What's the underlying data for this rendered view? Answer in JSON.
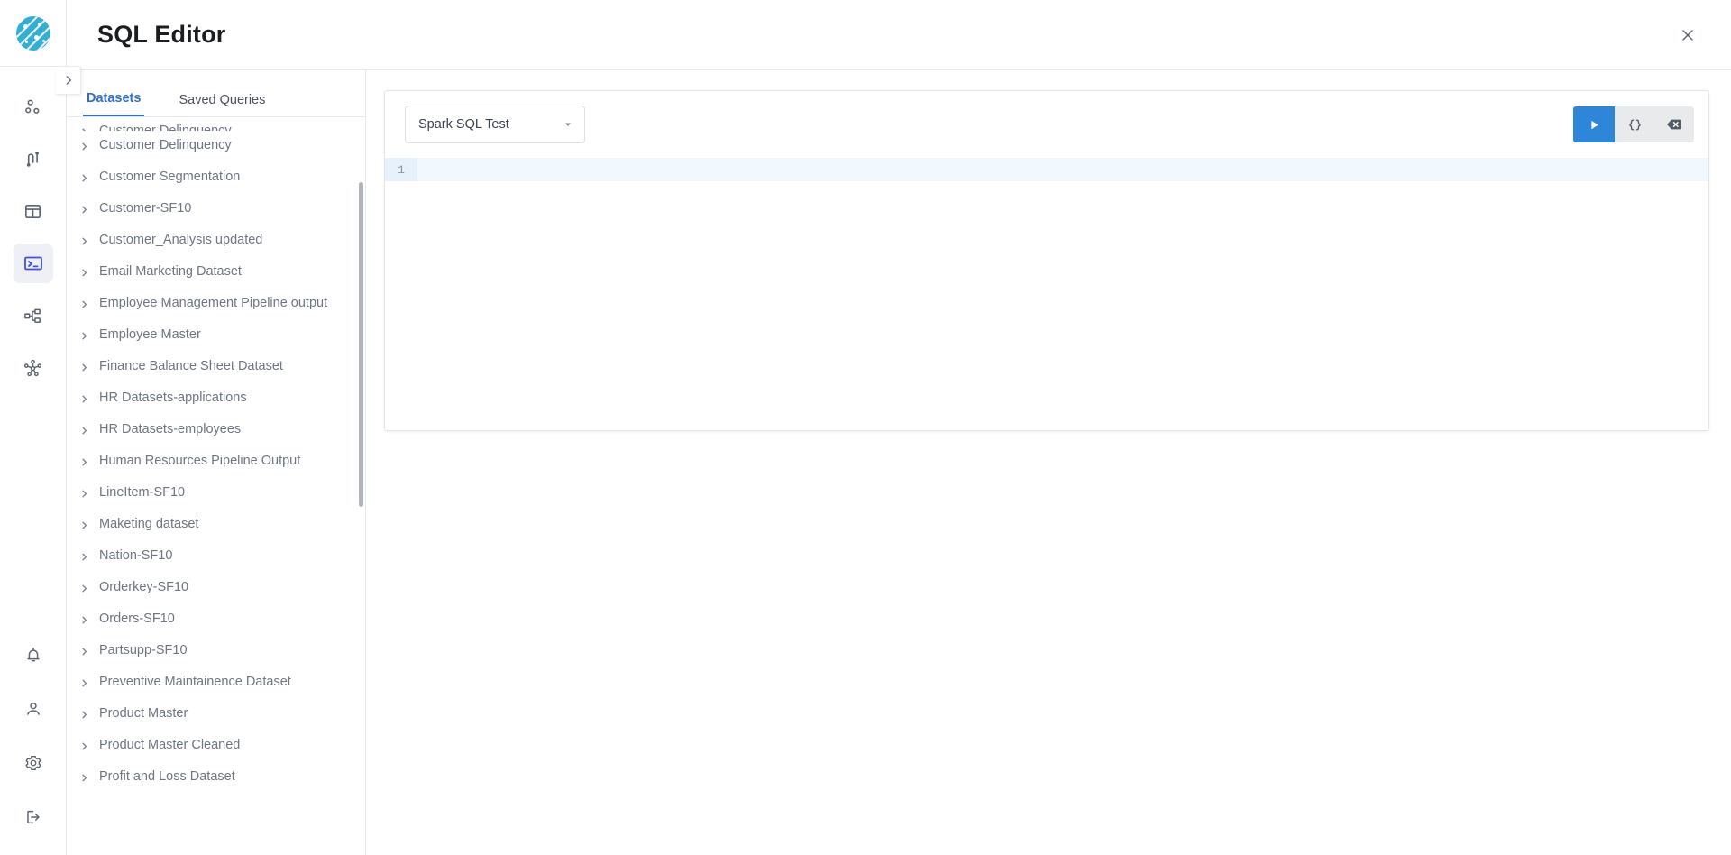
{
  "app": {
    "logo_icon": "circular-textured-logo",
    "title": "SQL Editor",
    "close_icon": "close-icon",
    "collapse_icon": "chevron-right-icon"
  },
  "rail": {
    "items": [
      {
        "name": "data-nodes",
        "icon": "scatter-nodes-icon",
        "active": false
      },
      {
        "name": "pipelines",
        "icon": "connectors-icon",
        "active": false
      },
      {
        "name": "tables",
        "icon": "table-icon",
        "active": false
      },
      {
        "name": "sql-editor",
        "icon": "terminal-icon",
        "active": true
      },
      {
        "name": "workflow",
        "icon": "hierarchy-icon",
        "active": false
      },
      {
        "name": "lineage",
        "icon": "network-graph-icon",
        "active": false
      }
    ],
    "bottom_items": [
      {
        "name": "notifications",
        "icon": "bell-icon"
      },
      {
        "name": "profile",
        "icon": "user-icon"
      },
      {
        "name": "settings",
        "icon": "gear-icon"
      },
      {
        "name": "logout",
        "icon": "logout-icon"
      }
    ]
  },
  "panel": {
    "tabs": [
      {
        "label": "Datasets",
        "active": true
      },
      {
        "label": "Saved Queries",
        "active": false
      }
    ],
    "datasets": [
      {
        "label": "Customer Delinquency",
        "clipped": "top"
      },
      {
        "label": "Customer Delinquency"
      },
      {
        "label": "Customer Segmentation"
      },
      {
        "label": "Customer-SF10"
      },
      {
        "label": "Customer_Analysis updated"
      },
      {
        "label": "Email Marketing Dataset"
      },
      {
        "label": "Employee Management Pipeline output"
      },
      {
        "label": "Employee Master"
      },
      {
        "label": "Finance Balance Sheet Dataset"
      },
      {
        "label": "HR Datasets-applications"
      },
      {
        "label": "HR Datasets-employees"
      },
      {
        "label": "Human Resources Pipeline Output"
      },
      {
        "label": "LineItem-SF10"
      },
      {
        "label": "Maketing dataset"
      },
      {
        "label": "Nation-SF10"
      },
      {
        "label": "Orderkey-SF10"
      },
      {
        "label": "Orders-SF10"
      },
      {
        "label": "Partsupp-SF10"
      },
      {
        "label": "Preventive Maintainence Dataset"
      },
      {
        "label": "Product Master"
      },
      {
        "label": "Product Master Cleaned"
      },
      {
        "label": "Profit and Loss Dataset"
      }
    ],
    "item_caret_icon": "chevron-right-icon"
  },
  "editor": {
    "dataset_select": {
      "value": "Spark SQL Test",
      "caret_icon": "chevron-down-icon"
    },
    "actions": [
      {
        "name": "run-query-button",
        "icon": "play-icon",
        "primary": true
      },
      {
        "name": "format-query-button",
        "icon": "braces-icon",
        "primary": false
      },
      {
        "name": "clear-query-button",
        "icon": "backspace-delete-icon",
        "primary": false
      }
    ],
    "line_numbers": [
      "1"
    ],
    "code": [
      ""
    ]
  },
  "colors": {
    "brand_logo": "#35aed4",
    "tab_active": "#2f6fd0",
    "run_button": "#2e86d8",
    "rail_active_bg": "#eef0f6",
    "rail_active_fg": "#3f51e0",
    "active_line": "#f1f8fe"
  }
}
